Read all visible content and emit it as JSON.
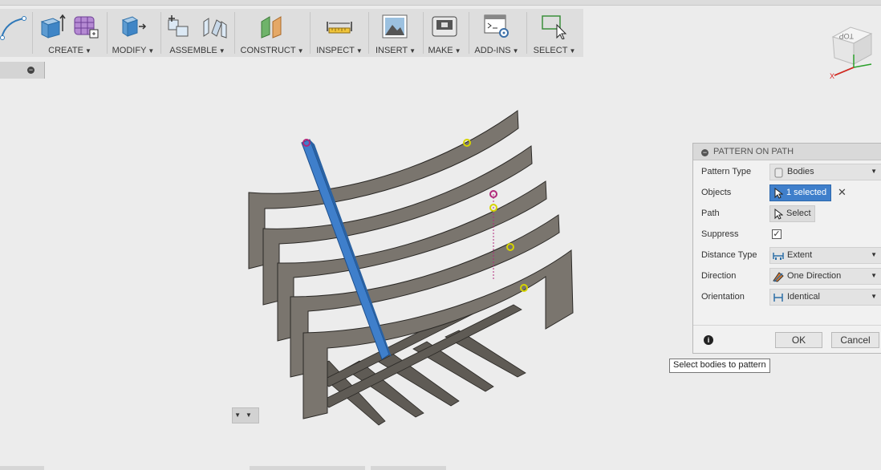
{
  "toolbar": {
    "groups": [
      {
        "label": "CREATE"
      },
      {
        "label": "MODIFY"
      },
      {
        "label": "ASSEMBLE"
      },
      {
        "label": "CONSTRUCT"
      },
      {
        "label": "INSPECT"
      },
      {
        "label": "INSERT"
      },
      {
        "label": "MAKE"
      },
      {
        "label": "ADD-INS"
      },
      {
        "label": "SELECT"
      }
    ]
  },
  "viewcube": {
    "face_label": "TOP",
    "axis_x": "X"
  },
  "panel": {
    "title": "PATTERN ON PATH",
    "rows": {
      "pattern_type": {
        "label": "Pattern Type",
        "value": "Bodies"
      },
      "objects": {
        "label": "Objects",
        "value": "1 selected"
      },
      "path": {
        "label": "Path",
        "value": "Select"
      },
      "suppress": {
        "label": "Suppress",
        "checked": true
      },
      "distance_type": {
        "label": "Distance Type",
        "value": "Extent"
      },
      "direction": {
        "label": "Direction",
        "value": "One Direction"
      },
      "orientation": {
        "label": "Orientation",
        "value": "Identical"
      }
    },
    "ok_label": "OK",
    "cancel_label": "Cancel"
  },
  "tooltip": {
    "text": "Select bodies to pattern"
  },
  "colors": {
    "selected_body": "#3f7fcb",
    "model_body": "#6b6660",
    "accent_yellow": "#d6d400",
    "path_magenta": "#b0287a"
  }
}
